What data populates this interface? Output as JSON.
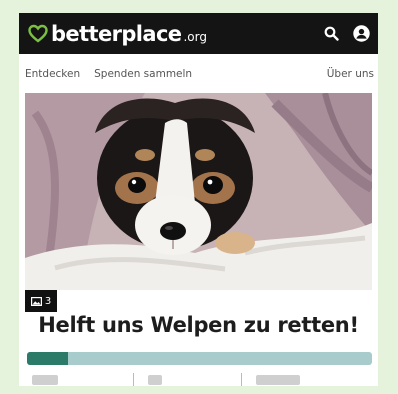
{
  "header": {
    "logo_text": "betterplace",
    "logo_tld": ".org",
    "brand_color": "#7cc043",
    "icons": [
      "search-icon",
      "user-account-icon"
    ]
  },
  "nav": {
    "items": [
      "Entdecken",
      "Spenden sammeln",
      "Über uns"
    ]
  },
  "project": {
    "photo_count": "3",
    "title": "Helft uns Welpen zu retten!",
    "progress_fraction": 0.12,
    "progress_fill_color": "#2c7a68",
    "progress_track_color": "#a8cccb"
  }
}
